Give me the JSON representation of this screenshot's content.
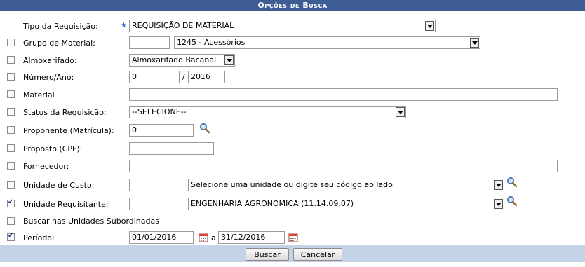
{
  "title": "Opções de Busca",
  "fields": {
    "tipo": {
      "label": "Tipo da Requisição:",
      "value": "REQUISIÇÃO DE MATERIAL"
    },
    "grupo": {
      "label": "Grupo de Material:",
      "code": "",
      "value": "1245 - Acessórios"
    },
    "almox": {
      "label": "Almoxarifado:",
      "value": "Almoxarifado Bacanal"
    },
    "numero": {
      "label": "Número/Ano:",
      "numero": "0",
      "sep": "/",
      "ano": "2016"
    },
    "material": {
      "label": "Material",
      "value": ""
    },
    "status": {
      "label": "Status da Requisição:",
      "value": "--SELECIONE--"
    },
    "proponente": {
      "label": "Proponente (Matrícula):",
      "value": "0"
    },
    "proposto": {
      "label": "Proposto (CPF):",
      "value": ""
    },
    "fornecedor": {
      "label": "Fornecedor:",
      "value": ""
    },
    "custo": {
      "label": "Unidade de Custo:",
      "code": "",
      "value": "Selecione uma unidade ou digite seu código ao lado."
    },
    "requisitante": {
      "label": "Unidade Requisitante:",
      "code": "",
      "value": "ENGENHARIA AGRONOMICA (11.14.09.07)"
    },
    "subordinadas": {
      "label": "Buscar nas Unidades Subordinadas"
    },
    "periodo": {
      "label": "Período:",
      "inicio": "01/01/2016",
      "sep": "a",
      "fim": "31/12/2016"
    }
  },
  "buttons": {
    "buscar": "Buscar",
    "cancelar": "Cancelar"
  },
  "checkboxes": {
    "grupo": false,
    "almox": false,
    "numero": false,
    "material": false,
    "status": false,
    "proponente": false,
    "proposto": false,
    "fornecedor": false,
    "custo": false,
    "requisitante": true,
    "subordinadas": false,
    "periodo": true
  },
  "icons": {
    "required": "star-icon",
    "search": "magnifier-icon",
    "calendar": "calendar-icon"
  },
  "colors": {
    "title_bg": "#3f5d95",
    "footer_bg": "#c5d3e8",
    "required": "#2a5bd7"
  }
}
